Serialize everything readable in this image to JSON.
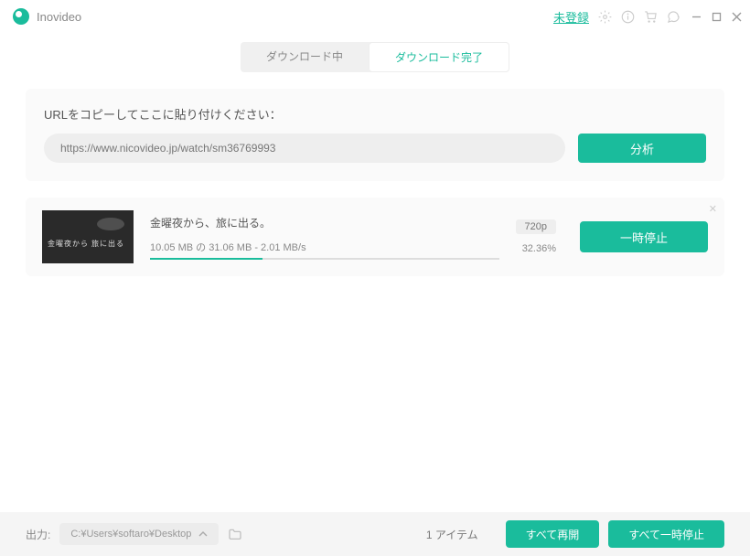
{
  "app": {
    "name": "Inovideo",
    "register": "未登録"
  },
  "tabs": {
    "downloading": "ダウンロード中",
    "completed": "ダウンロード完了"
  },
  "url": {
    "label": "URLをコピーしてここに貼り付けください：",
    "value": "https://www.nicovideo.jp/watch/sm36769993",
    "analyze": "分析"
  },
  "item": {
    "title": "金曜夜から、旅に出る。",
    "stats": "10.05 MB の 31.06 MB - 2.01 MB/s",
    "quality": "720p",
    "percent": "32.36%",
    "progress_pct": 32.36,
    "pause": "一時停止"
  },
  "footer": {
    "out_label": "出力:",
    "out_path": "C:¥Users¥softaro¥Desktop",
    "count": "1 アイテム",
    "resume_all": "すべて再開",
    "pause_all": "すべて一時停止"
  }
}
